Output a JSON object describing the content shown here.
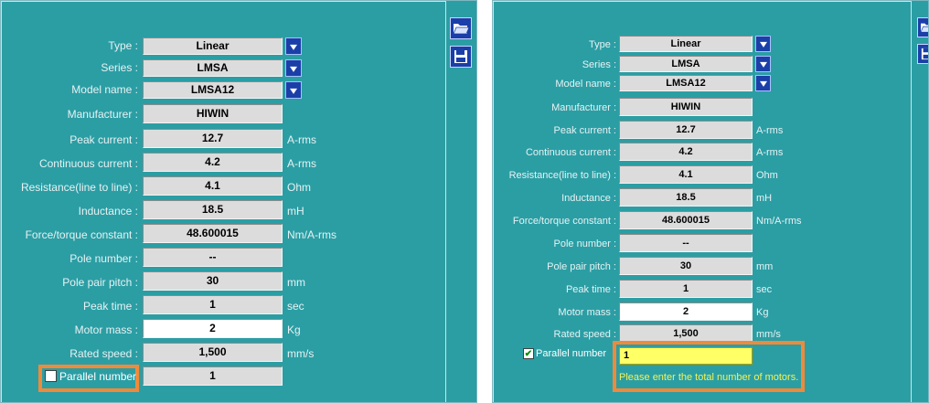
{
  "labels": {
    "type": "Type :",
    "series": "Series :",
    "model_name": "Model name :",
    "manufacturer": "Manufacturer :",
    "peak_current": "Peak current :",
    "continuous_current": "Continuous current :",
    "resistance": "Resistance(line to line) :",
    "inductance": "Inductance :",
    "force_constant": "Force/torque constant :",
    "pole_number": "Pole number :",
    "pole_pair_pitch": "Pole pair pitch :",
    "peak_time": "Peak time :",
    "motor_mass": "Motor mass :",
    "rated_speed": "Rated speed :",
    "parallel_number": "Parallel number"
  },
  "values": {
    "type": "Linear",
    "series": "LMSA",
    "model_name": "LMSA12",
    "manufacturer": "HIWIN",
    "peak_current": "12.7",
    "continuous_current": "4.2",
    "resistance": "4.1",
    "inductance": "18.5",
    "force_constant": "48.600015",
    "pole_number": "--",
    "pole_pair_pitch": "30",
    "peak_time": "1",
    "motor_mass": "2",
    "rated_speed": "1,500",
    "parallel_number": "1"
  },
  "units": {
    "peak_current": "A-rms",
    "continuous_current": "A-rms",
    "resistance": "Ohm",
    "inductance": "mH",
    "force_constant": "Nm/A-rms",
    "pole_pair_pitch": "mm",
    "peak_time": "sec",
    "motor_mass": "Kg",
    "rated_speed": "mm/s"
  },
  "right_panel": {
    "parallel_checked_mark": "✔",
    "hint": "Please enter the total number of motors."
  },
  "icons": {
    "open": "folder-open-icon",
    "save": "floppy-disk-icon",
    "dropdown": "dropdown-arrow-icon"
  },
  "colors": {
    "panel_bg": "#2b9ea4",
    "highlight": "#f08a3a",
    "hint_text": "#f2f25a",
    "button_blue": "#1b3fa8"
  }
}
